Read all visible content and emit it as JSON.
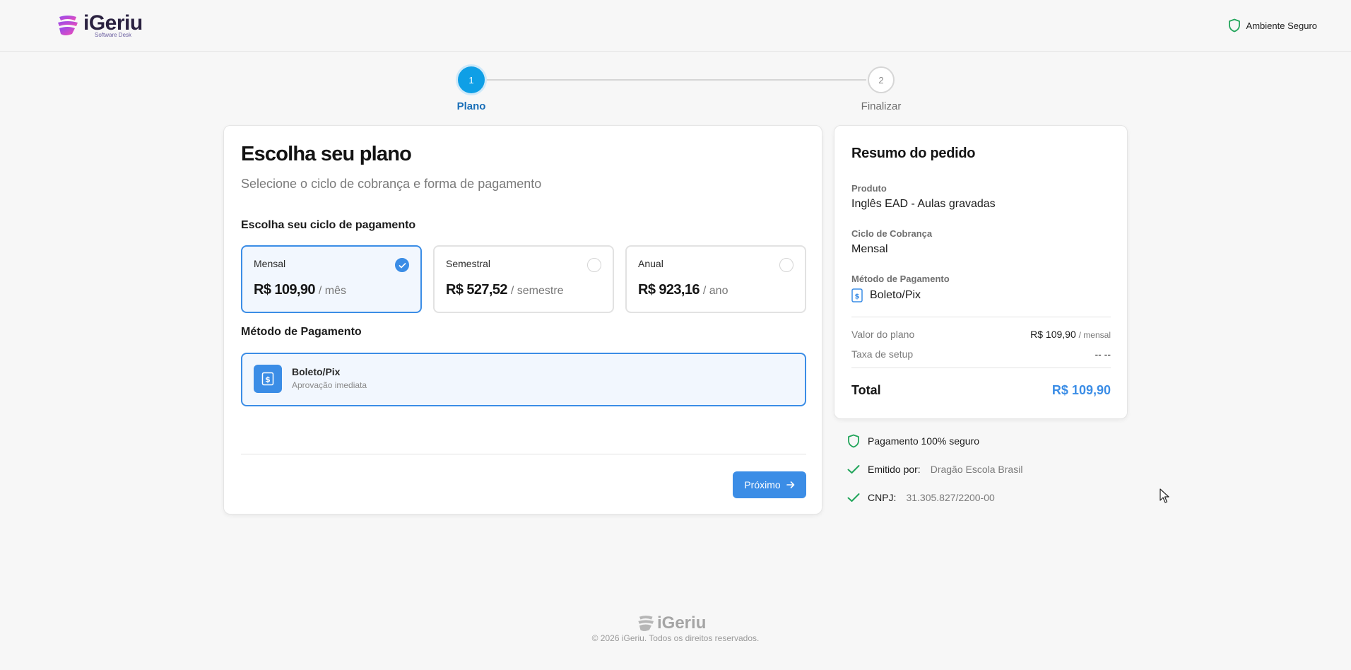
{
  "header": {
    "logo_word": "iGeriu",
    "logo_tagline": "Software Desk",
    "secure_label": "Ambiente Seguro"
  },
  "stepper": {
    "steps": [
      {
        "number": "1",
        "label": "Plano",
        "state": "active"
      },
      {
        "number": "2",
        "label": "Finalizar",
        "state": "idle"
      }
    ]
  },
  "main": {
    "title": "Escolha seu plano",
    "subtitle": "Selecione o ciclo de cobrança e forma de pagamento",
    "cycle_label": "Escolha seu ciclo de pagamento",
    "plans": [
      {
        "name": "Mensal",
        "price": "R$ 109,90",
        "period": "/ mês",
        "selected": true
      },
      {
        "name": "Semestral",
        "price": "R$ 527,52",
        "period": "/ semestre",
        "selected": false
      },
      {
        "name": "Anual",
        "price": "R$ 923,16",
        "period": "/ ano",
        "selected": false
      }
    ],
    "method_label": "Método de Pagamento",
    "method": {
      "name": "Boleto/Pix",
      "description": "Aprovação imediata",
      "icon": "dollar-document-icon"
    },
    "next_button": "Próximo"
  },
  "summary": {
    "title": "Resumo do pedido",
    "product_label": "Produto",
    "product_value": "Inglês EAD - Aulas gravadas",
    "cycle_label": "Ciclo de Cobrança",
    "cycle_value": "Mensal",
    "method_label": "Método de Pagamento",
    "method_value": "Boleto/Pix",
    "plan_value_label": "Valor do plano",
    "plan_value": "R$ 109,90",
    "plan_value_unit": "/ mensal",
    "setup_label": "Taxa de setup",
    "setup_value": "-- --",
    "total_label": "Total",
    "total_value": "R$ 109,90"
  },
  "trust": {
    "secure_payment": "Pagamento 100% seguro",
    "issued_by_label": "Emitido por:",
    "issued_by_value": "Dragão Escola Brasil",
    "cnpj_label": "CNPJ:",
    "cnpj_value": "31.305.827/2200-00"
  },
  "footer": {
    "logo_word": "iGeriu",
    "copyright": "© 2026 iGeriu. Todos os direitos reservados."
  },
  "colors": {
    "accent": "#3b8de6",
    "step_active": "#0f9fe6",
    "success": "#22a55b",
    "background": "#f7f7f7"
  }
}
